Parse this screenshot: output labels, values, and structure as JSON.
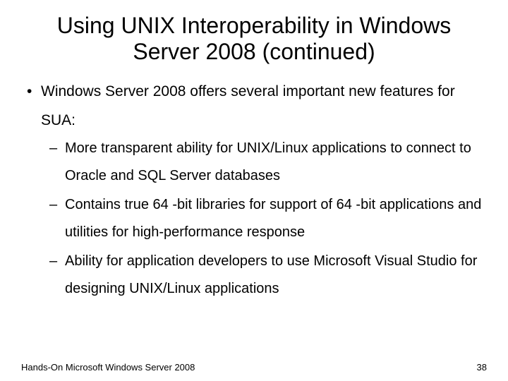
{
  "title": "Using UNIX Interoperability in Windows Server 2008 (continued)",
  "bullets": [
    {
      "text": "Windows Server 2008 offers several important new features for SUA:",
      "sub": [
        "More transparent ability for UNIX/Linux applications to connect to Oracle and SQL Server databases",
        "Contains true 64 -bit libraries for support of 64 -bit applications and utilities for high-performance response",
        "Ability for application developers to use Microsoft Visual Studio for designing UNIX/Linux applications"
      ]
    }
  ],
  "footer": {
    "left": "Hands-On Microsoft Windows Server 2008",
    "right": "38"
  }
}
